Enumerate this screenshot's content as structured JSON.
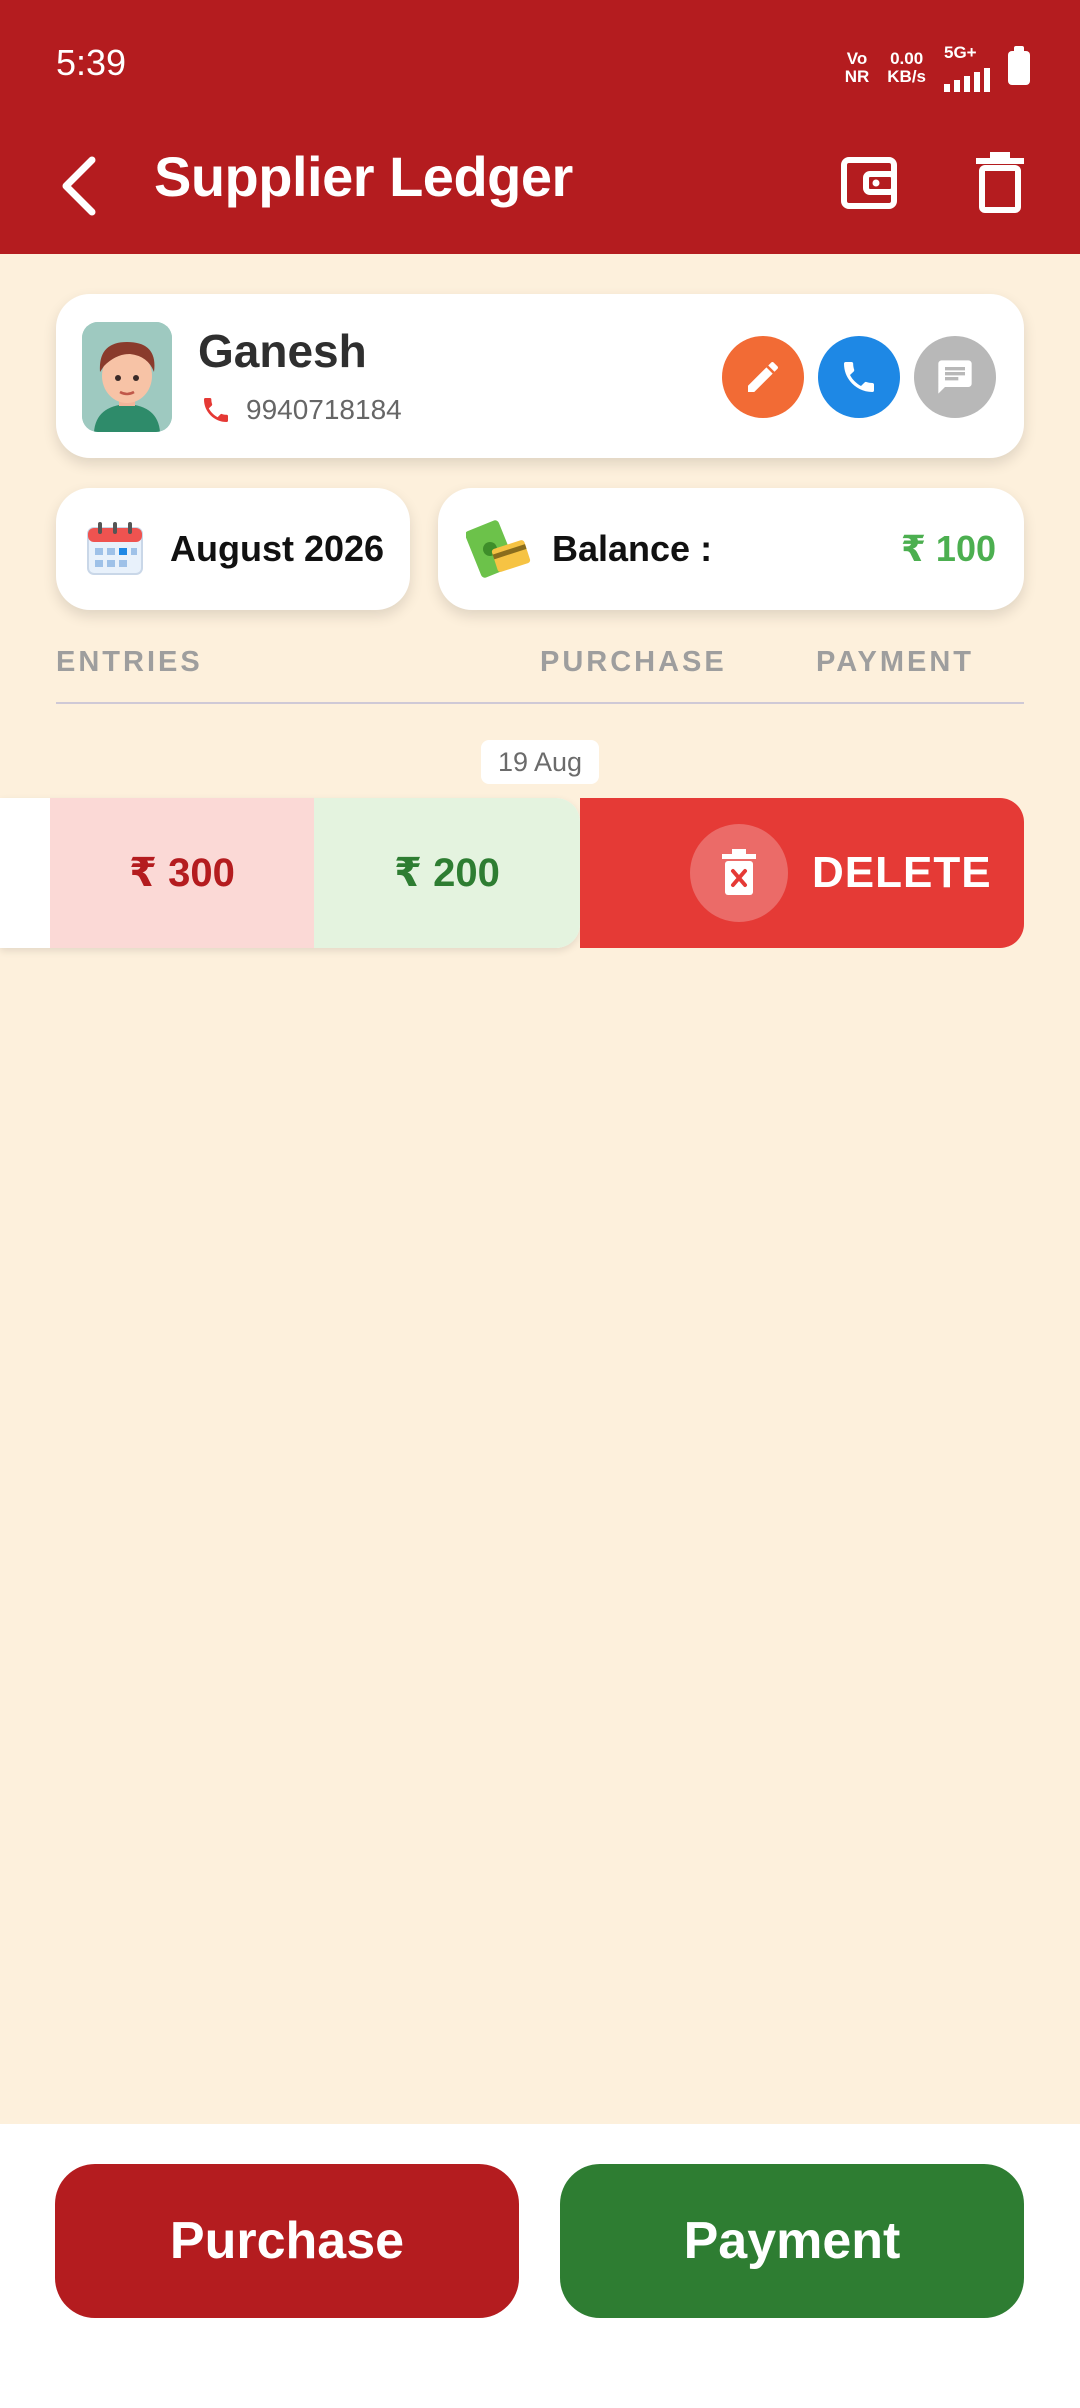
{
  "status_bar": {
    "time": "5:39",
    "net_type_top": "Vo",
    "net_type_bottom": "NR",
    "speed_value": "0.00",
    "speed_unit": "KB/s",
    "network": "5G+"
  },
  "app_bar": {
    "title": "Supplier Ledger"
  },
  "supplier": {
    "name": "Ganesh",
    "phone": "9940718184"
  },
  "summary": {
    "month": "August 2026",
    "balance_label": "Balance :",
    "balance_value": "₹ 100"
  },
  "columns": {
    "entries": "ENTRIES",
    "purchase": "PURCHASE",
    "payment": "PAYMENT"
  },
  "date_group": "19 Aug",
  "entry": {
    "purchase": "₹ 300",
    "payment": "₹ 200",
    "delete_label": "DELETE"
  },
  "actions": {
    "purchase": "Purchase",
    "payment": "Payment"
  },
  "colors": {
    "primary": "#b41c1f",
    "background": "#fdf0dc",
    "green": "#2e7d32",
    "balance_green": "#4caf50",
    "edit": "#f26b35",
    "call": "#1e88e5",
    "delete": "#e53a36"
  },
  "icons": [
    "back-arrow-icon",
    "wallet-icon",
    "trash-icon",
    "pencil-icon",
    "phone-icon",
    "message-icon",
    "calendar-icon",
    "money-icon",
    "delete-icon"
  ]
}
